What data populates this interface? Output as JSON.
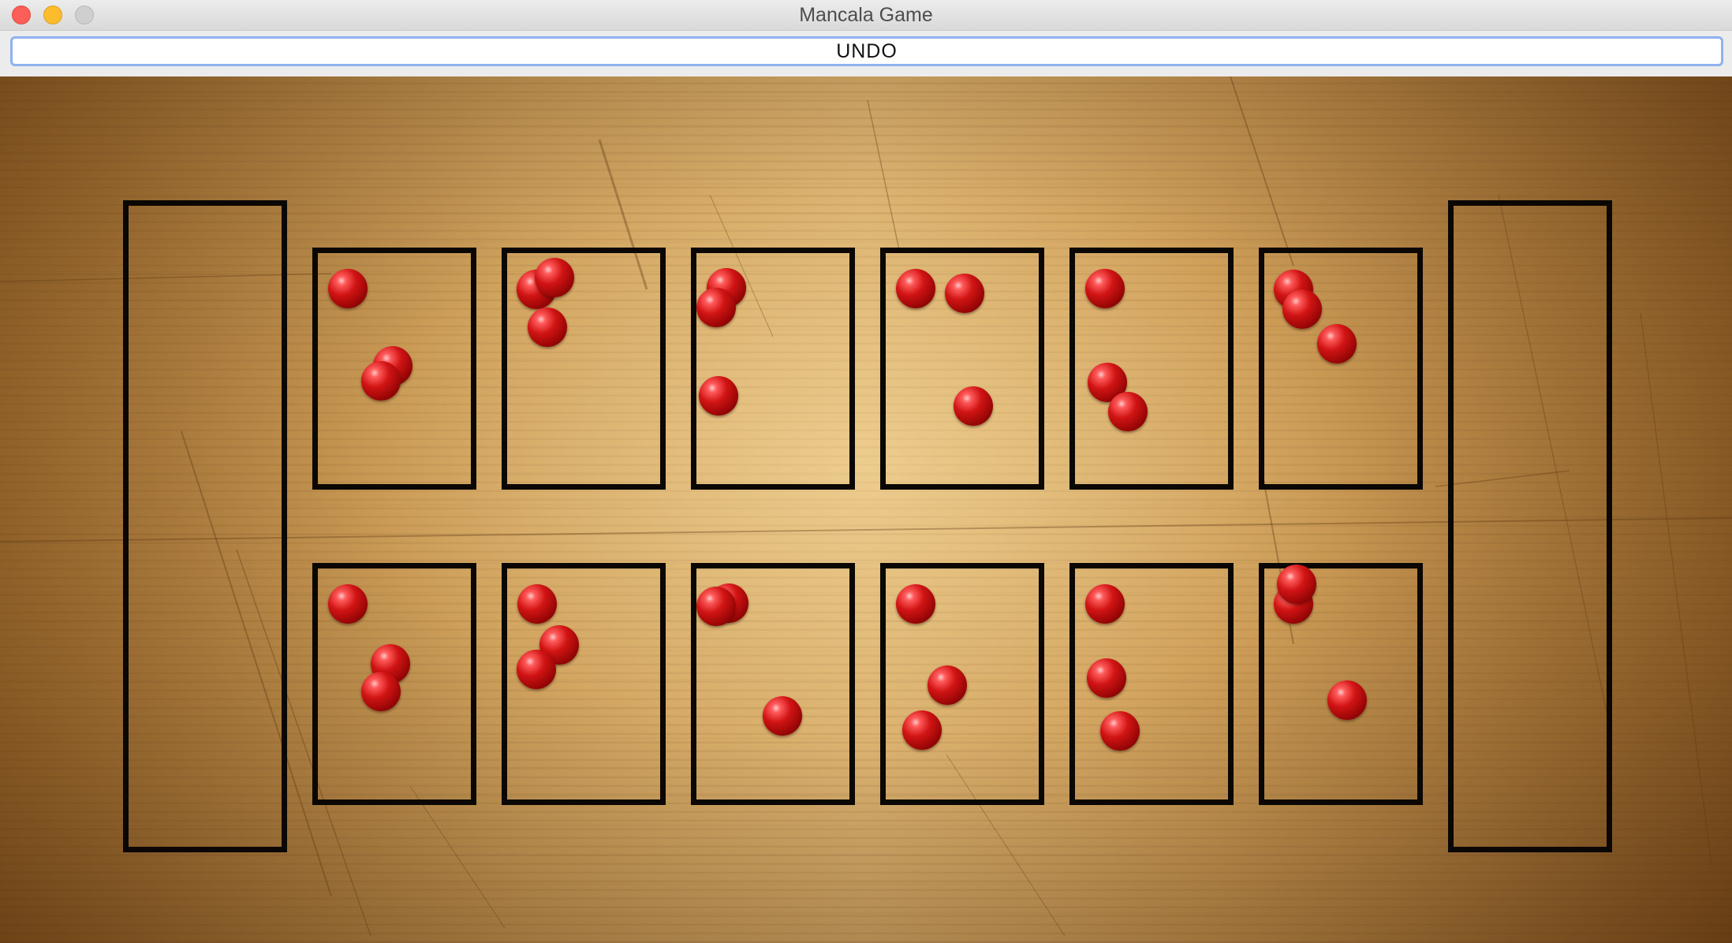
{
  "window": {
    "title": "Mancala Game"
  },
  "toolbar": {
    "undo_label": "UNDO"
  },
  "board": {
    "stores": [
      {
        "id": "store-left",
        "stones": 0
      },
      {
        "id": "store-right",
        "stones": 0
      }
    ],
    "top_row_pit_stones": [
      3,
      3,
      3,
      3,
      3,
      3
    ],
    "bottom_row_pit_stones": [
      3,
      3,
      3,
      3,
      3,
      3
    ],
    "stone_color": "#c81010",
    "outline_color": "#0b0704"
  }
}
